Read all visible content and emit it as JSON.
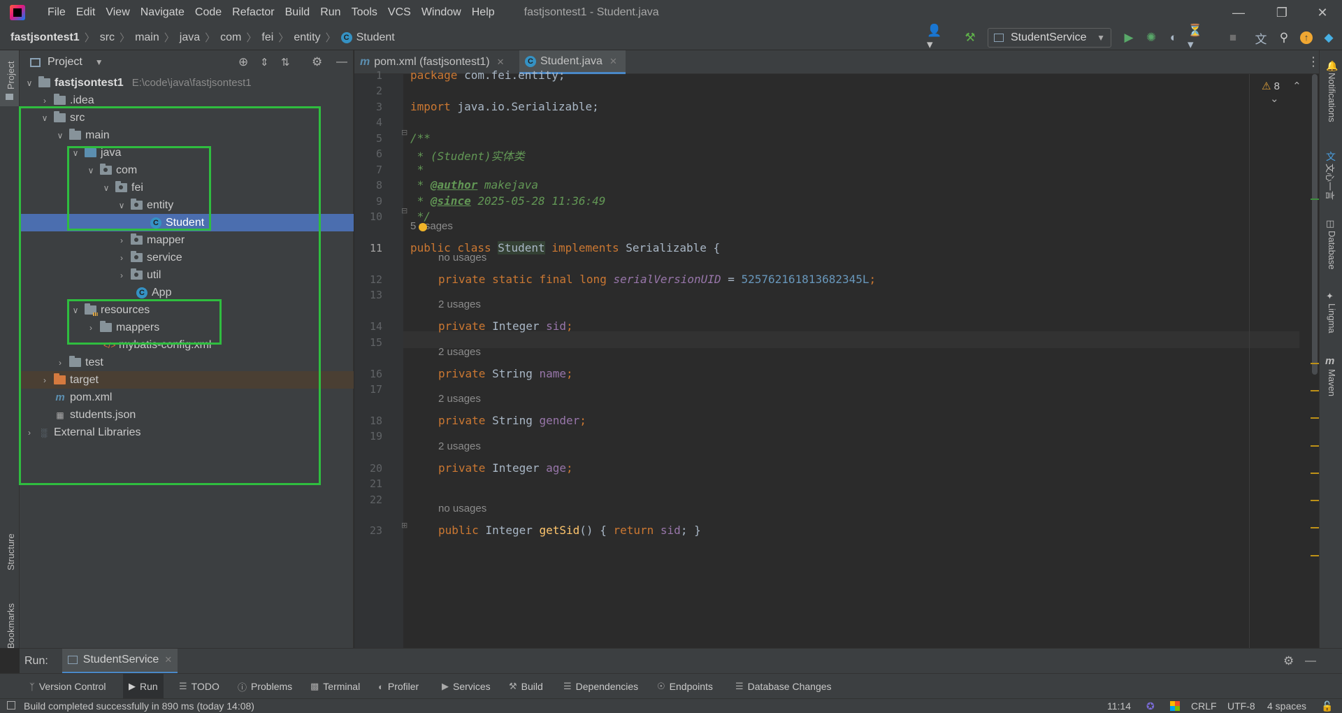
{
  "titlebar": {
    "menu": [
      "File",
      "Edit",
      "View",
      "Navigate",
      "Code",
      "Refactor",
      "Build",
      "Run",
      "Tools",
      "VCS",
      "Window",
      "Help"
    ],
    "window_title": "fastjsontest1 - Student.java"
  },
  "breadcrumb": [
    "fastjsontest1",
    "src",
    "main",
    "java",
    "com",
    "fei",
    "entity",
    "Student"
  ],
  "toolbar": {
    "run_config": "StudentService"
  },
  "project_panel": {
    "title": "Project",
    "tree": [
      {
        "label": "fastjsontest1",
        "path": "E:\\code\\java\\fastjsontest1"
      },
      {
        "label": ".idea"
      },
      {
        "label": "src"
      },
      {
        "label": "main"
      },
      {
        "label": "java"
      },
      {
        "label": "com"
      },
      {
        "label": "fei"
      },
      {
        "label": "entity"
      },
      {
        "label": "Student"
      },
      {
        "label": "mapper"
      },
      {
        "label": "service"
      },
      {
        "label": "util"
      },
      {
        "label": "App"
      },
      {
        "label": "resources"
      },
      {
        "label": "mappers"
      },
      {
        "label": "mybatis-config.xml"
      },
      {
        "label": "test"
      },
      {
        "label": "target"
      },
      {
        "label": "pom.xml"
      },
      {
        "label": "students.json"
      },
      {
        "label": "External Libraries"
      }
    ]
  },
  "editor": {
    "tabs": [
      {
        "label": "pom.xml (fastjsontest1)"
      },
      {
        "label": "Student.java"
      }
    ],
    "warnings_count": "8",
    "line_numbers": [
      "1",
      "2",
      "3",
      "4",
      "5",
      "6",
      "7",
      "8",
      "9",
      "10",
      "11",
      "12",
      "13",
      "14",
      "15",
      "16",
      "17",
      "18",
      "19",
      "20",
      "21",
      "22",
      "23"
    ],
    "hints": {
      "five_usages": "5 usages",
      "no_usages_1": "no usages",
      "usages_sid": "2 usages",
      "usages_name": "2 usages",
      "usages_gender": "2 usages",
      "usages_age": "2 usages",
      "no_usages_2": "no usages"
    },
    "code": {
      "l1_kw": "package",
      "l1_rest": " com.fei.entity;",
      "l3_kw": "import",
      "l3_rest": " java.io.Serializable;",
      "l5": "/**",
      "l6": " * (Student)实体类",
      "l7": " *",
      "l8_pre": " * ",
      "l8_tag": "@author",
      "l8_post": " makejava",
      "l9_pre": " * ",
      "l9_tag": "@since",
      "l9_post": " 2025-05-28 11:36:49",
      "l10": " */",
      "l11_kw": "public class ",
      "l11_cls": "Student",
      "l11_kw2": " implements ",
      "l11_rest": "Serializable {",
      "l12_kw": "private static final long ",
      "l12_fld": "serialVersionUID",
      "l12_eq": " = ",
      "l12_num": "525762161813682345L",
      "l12_end": ";",
      "l14_kw": "private ",
      "l14_type": "Integer ",
      "l14_fld": "sid",
      "l14_end": ";",
      "l16_kw": "private ",
      "l16_type": "String ",
      "l16_fld": "name",
      "l16_end": ";",
      "l18_kw": "private ",
      "l18_type": "String ",
      "l18_fld": "gender",
      "l18_end": ";",
      "l20_kw": "private ",
      "l20_type": "Integer ",
      "l20_fld": "age",
      "l20_end": ";",
      "l23_kw": "public ",
      "l23_type": "Integer ",
      "l23_mth": "getSid",
      "l23_mid": "() { ",
      "l23_kw2": "return ",
      "l23_fld": "sid",
      "l23_end": "; }"
    }
  },
  "left_stripe": {
    "project": "Project",
    "structure": "Structure",
    "bookmarks": "Bookmarks"
  },
  "right_stripe": {
    "notifications": "Notifications",
    "wenxin": "文心一言",
    "database": "Database",
    "lingma": "Lingma",
    "maven": "Maven"
  },
  "run_bar": {
    "label": "Run:",
    "tab": "StudentService"
  },
  "bottom_tools": [
    "Version Control",
    "Run",
    "TODO",
    "Problems",
    "Terminal",
    "Profiler",
    "Services",
    "Build",
    "Dependencies",
    "Endpoints",
    "Database Changes"
  ],
  "status": {
    "message": "Build completed successfully in 890 ms (today 14:08)",
    "position": "11:14",
    "line_sep": "CRLF",
    "encoding": "UTF-8",
    "indent": "4 spaces"
  }
}
